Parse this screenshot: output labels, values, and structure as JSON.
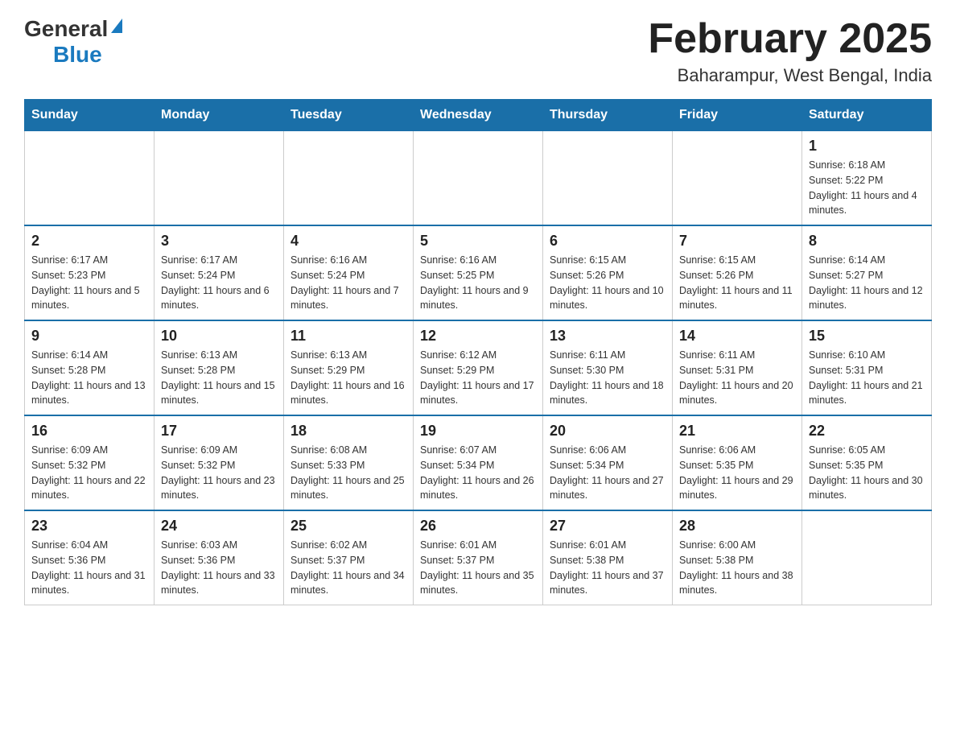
{
  "header": {
    "logo_general": "General",
    "logo_blue": "Blue",
    "title": "February 2025",
    "subtitle": "Baharampur, West Bengal, India"
  },
  "days_of_week": [
    "Sunday",
    "Monday",
    "Tuesday",
    "Wednesday",
    "Thursday",
    "Friday",
    "Saturday"
  ],
  "weeks": [
    [
      {
        "day": "",
        "info": ""
      },
      {
        "day": "",
        "info": ""
      },
      {
        "day": "",
        "info": ""
      },
      {
        "day": "",
        "info": ""
      },
      {
        "day": "",
        "info": ""
      },
      {
        "day": "",
        "info": ""
      },
      {
        "day": "1",
        "info": "Sunrise: 6:18 AM\nSunset: 5:22 PM\nDaylight: 11 hours and 4 minutes."
      }
    ],
    [
      {
        "day": "2",
        "info": "Sunrise: 6:17 AM\nSunset: 5:23 PM\nDaylight: 11 hours and 5 minutes."
      },
      {
        "day": "3",
        "info": "Sunrise: 6:17 AM\nSunset: 5:24 PM\nDaylight: 11 hours and 6 minutes."
      },
      {
        "day": "4",
        "info": "Sunrise: 6:16 AM\nSunset: 5:24 PM\nDaylight: 11 hours and 7 minutes."
      },
      {
        "day": "5",
        "info": "Sunrise: 6:16 AM\nSunset: 5:25 PM\nDaylight: 11 hours and 9 minutes."
      },
      {
        "day": "6",
        "info": "Sunrise: 6:15 AM\nSunset: 5:26 PM\nDaylight: 11 hours and 10 minutes."
      },
      {
        "day": "7",
        "info": "Sunrise: 6:15 AM\nSunset: 5:26 PM\nDaylight: 11 hours and 11 minutes."
      },
      {
        "day": "8",
        "info": "Sunrise: 6:14 AM\nSunset: 5:27 PM\nDaylight: 11 hours and 12 minutes."
      }
    ],
    [
      {
        "day": "9",
        "info": "Sunrise: 6:14 AM\nSunset: 5:28 PM\nDaylight: 11 hours and 13 minutes."
      },
      {
        "day": "10",
        "info": "Sunrise: 6:13 AM\nSunset: 5:28 PM\nDaylight: 11 hours and 15 minutes."
      },
      {
        "day": "11",
        "info": "Sunrise: 6:13 AM\nSunset: 5:29 PM\nDaylight: 11 hours and 16 minutes."
      },
      {
        "day": "12",
        "info": "Sunrise: 6:12 AM\nSunset: 5:29 PM\nDaylight: 11 hours and 17 minutes."
      },
      {
        "day": "13",
        "info": "Sunrise: 6:11 AM\nSunset: 5:30 PM\nDaylight: 11 hours and 18 minutes."
      },
      {
        "day": "14",
        "info": "Sunrise: 6:11 AM\nSunset: 5:31 PM\nDaylight: 11 hours and 20 minutes."
      },
      {
        "day": "15",
        "info": "Sunrise: 6:10 AM\nSunset: 5:31 PM\nDaylight: 11 hours and 21 minutes."
      }
    ],
    [
      {
        "day": "16",
        "info": "Sunrise: 6:09 AM\nSunset: 5:32 PM\nDaylight: 11 hours and 22 minutes."
      },
      {
        "day": "17",
        "info": "Sunrise: 6:09 AM\nSunset: 5:32 PM\nDaylight: 11 hours and 23 minutes."
      },
      {
        "day": "18",
        "info": "Sunrise: 6:08 AM\nSunset: 5:33 PM\nDaylight: 11 hours and 25 minutes."
      },
      {
        "day": "19",
        "info": "Sunrise: 6:07 AM\nSunset: 5:34 PM\nDaylight: 11 hours and 26 minutes."
      },
      {
        "day": "20",
        "info": "Sunrise: 6:06 AM\nSunset: 5:34 PM\nDaylight: 11 hours and 27 minutes."
      },
      {
        "day": "21",
        "info": "Sunrise: 6:06 AM\nSunset: 5:35 PM\nDaylight: 11 hours and 29 minutes."
      },
      {
        "day": "22",
        "info": "Sunrise: 6:05 AM\nSunset: 5:35 PM\nDaylight: 11 hours and 30 minutes."
      }
    ],
    [
      {
        "day": "23",
        "info": "Sunrise: 6:04 AM\nSunset: 5:36 PM\nDaylight: 11 hours and 31 minutes."
      },
      {
        "day": "24",
        "info": "Sunrise: 6:03 AM\nSunset: 5:36 PM\nDaylight: 11 hours and 33 minutes."
      },
      {
        "day": "25",
        "info": "Sunrise: 6:02 AM\nSunset: 5:37 PM\nDaylight: 11 hours and 34 minutes."
      },
      {
        "day": "26",
        "info": "Sunrise: 6:01 AM\nSunset: 5:37 PM\nDaylight: 11 hours and 35 minutes."
      },
      {
        "day": "27",
        "info": "Sunrise: 6:01 AM\nSunset: 5:38 PM\nDaylight: 11 hours and 37 minutes."
      },
      {
        "day": "28",
        "info": "Sunrise: 6:00 AM\nSunset: 5:38 PM\nDaylight: 11 hours and 38 minutes."
      },
      {
        "day": "",
        "info": ""
      }
    ]
  ]
}
